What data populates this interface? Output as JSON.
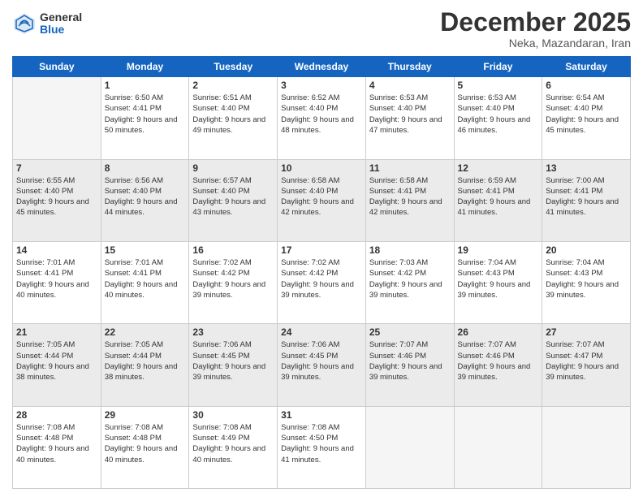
{
  "header": {
    "logo": {
      "general": "General",
      "blue": "Blue"
    },
    "title": "December 2025",
    "location": "Neka, Mazandaran, Iran"
  },
  "days_of_week": [
    "Sunday",
    "Monday",
    "Tuesday",
    "Wednesday",
    "Thursday",
    "Friday",
    "Saturday"
  ],
  "weeks": [
    [
      {
        "day": "",
        "empty": true
      },
      {
        "day": "1",
        "sunrise": "6:50 AM",
        "sunset": "4:41 PM",
        "daylight": "9 hours and 50 minutes."
      },
      {
        "day": "2",
        "sunrise": "6:51 AM",
        "sunset": "4:40 PM",
        "daylight": "9 hours and 49 minutes."
      },
      {
        "day": "3",
        "sunrise": "6:52 AM",
        "sunset": "4:40 PM",
        "daylight": "9 hours and 48 minutes."
      },
      {
        "day": "4",
        "sunrise": "6:53 AM",
        "sunset": "4:40 PM",
        "daylight": "9 hours and 47 minutes."
      },
      {
        "day": "5",
        "sunrise": "6:53 AM",
        "sunset": "4:40 PM",
        "daylight": "9 hours and 46 minutes."
      },
      {
        "day": "6",
        "sunrise": "6:54 AM",
        "sunset": "4:40 PM",
        "daylight": "9 hours and 45 minutes."
      }
    ],
    [
      {
        "day": "7",
        "sunrise": "6:55 AM",
        "sunset": "4:40 PM",
        "daylight": "9 hours and 45 minutes."
      },
      {
        "day": "8",
        "sunrise": "6:56 AM",
        "sunset": "4:40 PM",
        "daylight": "9 hours and 44 minutes."
      },
      {
        "day": "9",
        "sunrise": "6:57 AM",
        "sunset": "4:40 PM",
        "daylight": "9 hours and 43 minutes."
      },
      {
        "day": "10",
        "sunrise": "6:58 AM",
        "sunset": "4:40 PM",
        "daylight": "9 hours and 42 minutes."
      },
      {
        "day": "11",
        "sunrise": "6:58 AM",
        "sunset": "4:41 PM",
        "daylight": "9 hours and 42 minutes."
      },
      {
        "day": "12",
        "sunrise": "6:59 AM",
        "sunset": "4:41 PM",
        "daylight": "9 hours and 41 minutes."
      },
      {
        "day": "13",
        "sunrise": "7:00 AM",
        "sunset": "4:41 PM",
        "daylight": "9 hours and 41 minutes."
      }
    ],
    [
      {
        "day": "14",
        "sunrise": "7:01 AM",
        "sunset": "4:41 PM",
        "daylight": "9 hours and 40 minutes."
      },
      {
        "day": "15",
        "sunrise": "7:01 AM",
        "sunset": "4:41 PM",
        "daylight": "9 hours and 40 minutes."
      },
      {
        "day": "16",
        "sunrise": "7:02 AM",
        "sunset": "4:42 PM",
        "daylight": "9 hours and 39 minutes."
      },
      {
        "day": "17",
        "sunrise": "7:02 AM",
        "sunset": "4:42 PM",
        "daylight": "9 hours and 39 minutes."
      },
      {
        "day": "18",
        "sunrise": "7:03 AM",
        "sunset": "4:42 PM",
        "daylight": "9 hours and 39 minutes."
      },
      {
        "day": "19",
        "sunrise": "7:04 AM",
        "sunset": "4:43 PM",
        "daylight": "9 hours and 39 minutes."
      },
      {
        "day": "20",
        "sunrise": "7:04 AM",
        "sunset": "4:43 PM",
        "daylight": "9 hours and 39 minutes."
      }
    ],
    [
      {
        "day": "21",
        "sunrise": "7:05 AM",
        "sunset": "4:44 PM",
        "daylight": "9 hours and 38 minutes."
      },
      {
        "day": "22",
        "sunrise": "7:05 AM",
        "sunset": "4:44 PM",
        "daylight": "9 hours and 38 minutes."
      },
      {
        "day": "23",
        "sunrise": "7:06 AM",
        "sunset": "4:45 PM",
        "daylight": "9 hours and 39 minutes."
      },
      {
        "day": "24",
        "sunrise": "7:06 AM",
        "sunset": "4:45 PM",
        "daylight": "9 hours and 39 minutes."
      },
      {
        "day": "25",
        "sunrise": "7:07 AM",
        "sunset": "4:46 PM",
        "daylight": "9 hours and 39 minutes."
      },
      {
        "day": "26",
        "sunrise": "7:07 AM",
        "sunset": "4:46 PM",
        "daylight": "9 hours and 39 minutes."
      },
      {
        "day": "27",
        "sunrise": "7:07 AM",
        "sunset": "4:47 PM",
        "daylight": "9 hours and 39 minutes."
      }
    ],
    [
      {
        "day": "28",
        "sunrise": "7:08 AM",
        "sunset": "4:48 PM",
        "daylight": "9 hours and 40 minutes."
      },
      {
        "day": "29",
        "sunrise": "7:08 AM",
        "sunset": "4:48 PM",
        "daylight": "9 hours and 40 minutes."
      },
      {
        "day": "30",
        "sunrise": "7:08 AM",
        "sunset": "4:49 PM",
        "daylight": "9 hours and 40 minutes."
      },
      {
        "day": "31",
        "sunrise": "7:08 AM",
        "sunset": "4:50 PM",
        "daylight": "9 hours and 41 minutes."
      },
      {
        "day": "",
        "empty": true
      },
      {
        "day": "",
        "empty": true
      },
      {
        "day": "",
        "empty": true
      }
    ]
  ],
  "shaded_rows": [
    1,
    3
  ]
}
